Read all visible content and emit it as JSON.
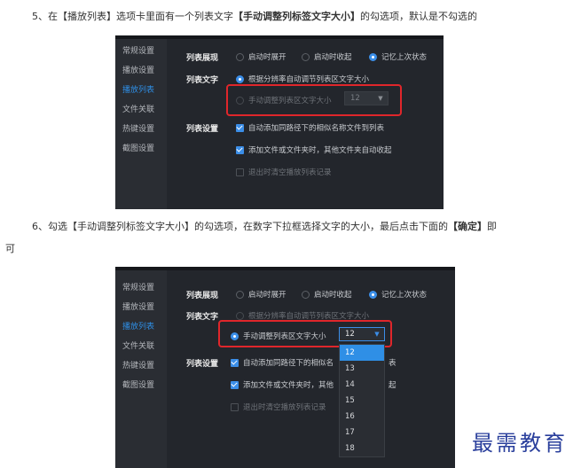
{
  "step5": {
    "prefix": "5、在【播放列表】选项卡里面有一个列表文字",
    "highlight": "【手动调整列标签文字大小】",
    "suffix": "的勾选项，默认是不勾选的"
  },
  "step6": {
    "line1_prefix": "6、勾选【手动调整列标签文字大小】的勾选项，在数字下拉框选择文字的大小，最后点击下面的",
    "line1_highlight": "【确定】",
    "line1_suffix": "即",
    "line2": "可"
  },
  "settings_sidebar": [
    "常规设置",
    "播放设置",
    "播放列表",
    "文件关联",
    "热键设置",
    "截图设置"
  ],
  "active_sidebar_item": "播放列表",
  "list_display": {
    "label": "列表展现",
    "options": [
      "启动时展开",
      "启动时收起",
      "记忆上次状态"
    ],
    "selected": "记忆上次状态"
  },
  "list_text": {
    "label": "列表文字",
    "auto_option": "根据分辨率自动调节列表区文字大小",
    "manual_option": "手动调整列表区文字大小",
    "size_value": "12"
  },
  "list_settings": {
    "label": "列表设置",
    "check1": "自动添加同路径下的相似名称文件到列表",
    "check1_cut": "自动添加同路径下的相似名",
    "check1_tail": "表",
    "check2": "添加文件或文件夹时，其他文件夹自动收起",
    "check2_cut": "添加文件或文件夹时，其他",
    "check2_tail": "起",
    "check3": "退出时清空播放列表记录"
  },
  "size_options": [
    "12",
    "13",
    "14",
    "15",
    "16",
    "17",
    "18"
  ],
  "selected_size": "12",
  "watermark": "最需教育",
  "colors": {
    "accent": "#2f8fe6",
    "highlight_box": "#e0262b",
    "panel_bg": "#23262c",
    "watermark": "#2a3f9c"
  }
}
